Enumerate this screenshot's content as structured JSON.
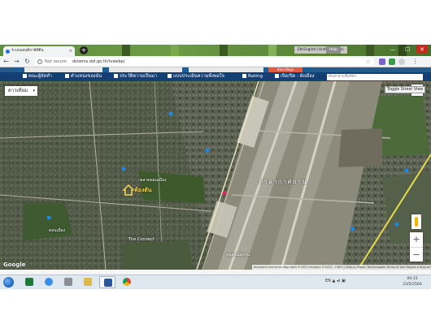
{
  "browser": {
    "tab_title": "ระบบแผนที่ภาษีทีดิน",
    "tab_close": "×",
    "new_tab": "+",
    "language_button": "EN English (United States)",
    "help_button": "Help",
    "minimize": "—",
    "maximize": "☐",
    "close": "✕",
    "back": "←",
    "forward": "→",
    "reload": "↻",
    "security_label": "Not secure",
    "url": "dolwms.dol.go.th/tvwebp/",
    "star": "☆",
    "menu": "⋮"
  },
  "site": {
    "header_action": "ค้นหาข้อมูล",
    "nav": [
      {
        "label": "คณะผู้จัดทำ",
        "icon": "people-icon"
      },
      {
        "label": "ตำแหน่งของฉัน",
        "icon": "location-icon"
      },
      {
        "label": "ประวัติความเป็นมา",
        "icon": "history-icon"
      },
      {
        "label": "แบบประเมินความพึงพอใจ",
        "icon": "survey-icon"
      },
      {
        "label": "Rating",
        "icon": "rating-icon"
      },
      {
        "label": "เปิด/ปิด - ผังเมือง",
        "icon": "layers-icon"
      }
    ],
    "search_placeholder": "ค้นหาตามชื่อที่ตั้ง"
  },
  "map": {
    "map_type": "ดาวเทียม",
    "map_type_chevron": "▾",
    "toggle_street_view": "Toggle Street View",
    "fullscreen": "⛶",
    "zoom_in": "+",
    "zoom_out": "−",
    "marker_label": "ห้องตัน",
    "airport_label": "ท่าอากาศยาน",
    "poi_labels": [
      "The Connect",
      "ตลาดดอนเมือง",
      "อนุสรณ์สถาน",
      "ดอนเมือง"
    ],
    "google_logo": "Google",
    "attribution": "Keyboard shortcuts   Map data ©2023 Imagery ©2023 , CNES / Airbus, Maxar Technologies   Terms of Use   Report a map error"
  },
  "taskbar": {
    "tray_text": "EN ▲ ◂) ▣",
    "time": "09:15",
    "date": "23/5/2566"
  },
  "colors": {
    "site_nav": "#143f73",
    "accent": "#e35b3d",
    "marker": "#f6d54a"
  }
}
